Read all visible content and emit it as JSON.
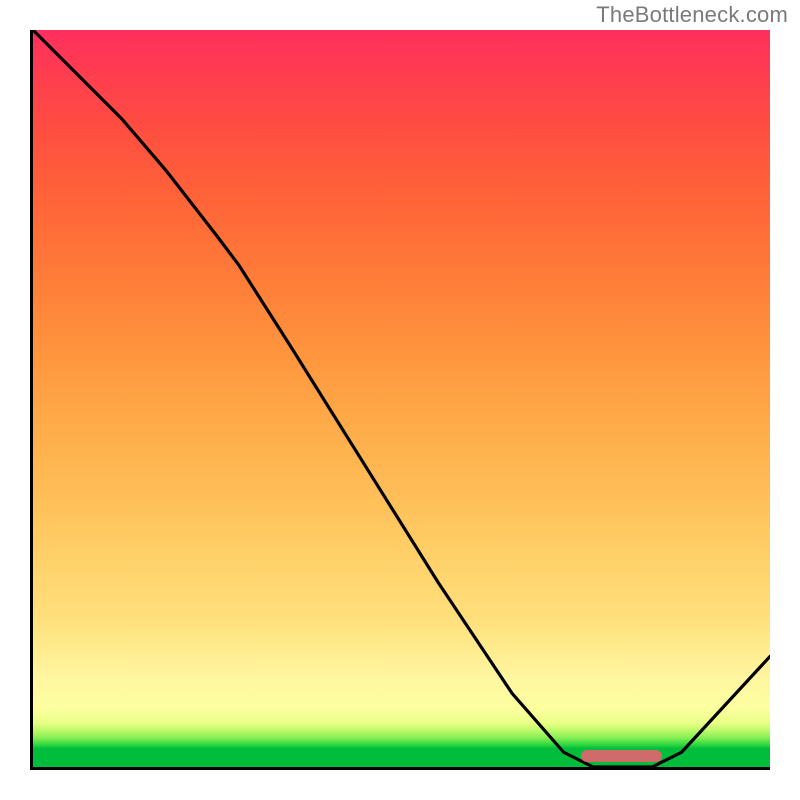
{
  "attribution": "TheBottleneck.com",
  "chart_data": {
    "type": "line",
    "title": "",
    "xlabel": "",
    "ylabel": "",
    "xlim": [
      0,
      100
    ],
    "ylim": [
      0,
      100
    ],
    "series": [
      {
        "name": "curve",
        "x": [
          0,
          6,
          12,
          18,
          25,
          28,
          35,
          45,
          55,
          65,
          72,
          76,
          80,
          84,
          88,
          100
        ],
        "y": [
          100,
          94,
          88,
          81,
          72,
          68,
          57,
          41,
          25,
          10,
          2,
          0,
          0,
          0,
          2,
          15
        ]
      }
    ],
    "legend": false,
    "grid": false,
    "gradient_bands": [
      {
        "y": 0,
        "color": "#00bd3c"
      },
      {
        "y": 6,
        "color": "#eaff87"
      },
      {
        "y": 20,
        "color": "#ffe07c"
      },
      {
        "y": 50,
        "color": "#ffa044"
      },
      {
        "y": 80,
        "color": "#ff5c3c"
      },
      {
        "y": 100,
        "color": "#ff2f5e"
      }
    ],
    "annotations": [
      {
        "kind": "minimum-marker",
        "x_start": 74,
        "x_end": 85,
        "y": 0,
        "color": "#cf6b6b"
      }
    ]
  }
}
